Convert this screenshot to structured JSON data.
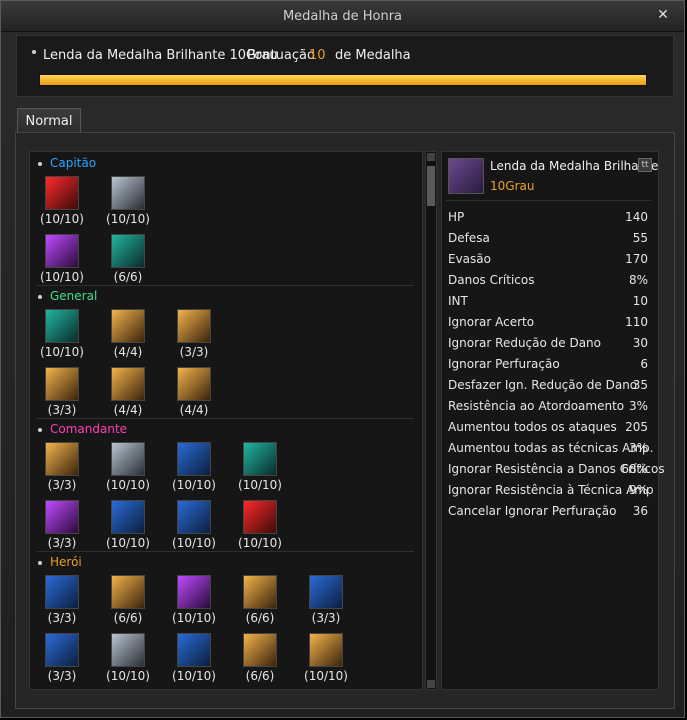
{
  "window": {
    "title": "Medalha de Honra"
  },
  "header": {
    "medal_label": "Lenda da Medalha Brilhante 10Grau",
    "score_label": "Pontuação",
    "score_value": "10",
    "medal_name": "de Medalha",
    "progress_fraction": 1.0
  },
  "tabs": [
    {
      "label": "Normal"
    }
  ],
  "groups": [
    {
      "name": "Capitão",
      "color": "#2aa7ff",
      "skills": [
        {
          "count": "(10/10)",
          "icon": "red"
        },
        {
          "count": "(10/10)",
          "icon": "silver"
        },
        {
          "count": "(10/10)",
          "icon": "purple"
        },
        {
          "count": "(6/6)",
          "icon": "green"
        }
      ]
    },
    {
      "name": "General",
      "color": "#3fe08a",
      "skills": [
        {
          "count": "(10/10)",
          "icon": "green"
        },
        {
          "count": "(4/4)",
          "icon": "gold"
        },
        {
          "count": "(3/3)",
          "icon": "gold"
        },
        {
          "count": "(3/3)",
          "icon": "gold"
        },
        {
          "count": "(4/4)",
          "icon": "gold"
        },
        {
          "count": "(4/4)",
          "icon": "gold"
        }
      ]
    },
    {
      "name": "Comandante",
      "color": "#ff3fb5",
      "skills": [
        {
          "count": "(3/3)",
          "icon": "gold"
        },
        {
          "count": "(10/10)",
          "icon": "silver"
        },
        {
          "count": "(10/10)",
          "icon": "blue"
        },
        {
          "count": "(10/10)",
          "icon": "green"
        },
        {
          "count": "(3/3)",
          "icon": "purple"
        },
        {
          "count": "(10/10)",
          "icon": "blue"
        },
        {
          "count": "(10/10)",
          "icon": "blue"
        },
        {
          "count": "(10/10)",
          "icon": "red"
        }
      ]
    },
    {
      "name": "Herói",
      "color": "#e8a12a",
      "skills": [
        {
          "count": "(3/3)",
          "icon": "blue"
        },
        {
          "count": "(6/6)",
          "icon": "gold"
        },
        {
          "count": "(10/10)",
          "icon": "purple"
        },
        {
          "count": "(6/6)",
          "icon": "gold"
        },
        {
          "count": "(3/3)",
          "icon": "blue"
        },
        {
          "count": "(3/3)",
          "icon": "blue"
        },
        {
          "count": "(10/10)",
          "icon": "silver"
        },
        {
          "count": "(10/10)",
          "icon": "blue"
        },
        {
          "count": "(6/6)",
          "icon": "gold"
        },
        {
          "count": "(10/10)",
          "icon": "gold"
        }
      ]
    }
  ],
  "detail": {
    "title": "Lenda da Medalha Brilhante",
    "grade": "10Grau",
    "lock_label": "tt",
    "stats": [
      {
        "name": "HP",
        "value": "140"
      },
      {
        "name": "Defesa",
        "value": "55"
      },
      {
        "name": "Evasão",
        "value": "170"
      },
      {
        "name": "Danos Críticos",
        "value": "8%"
      },
      {
        "name": "INT",
        "value": "10"
      },
      {
        "name": "Ignorar Acerto",
        "value": "110"
      },
      {
        "name": "Ignorar Redução de Dano",
        "value": "30"
      },
      {
        "name": "Ignorar Perfuração",
        "value": "6"
      },
      {
        "name": "Desfazer Ign. Redução de Dano",
        "value": "35"
      },
      {
        "name": "Resistência ao Atordoamento",
        "value": "3%"
      },
      {
        "name": "Aumentou todos os ataques",
        "value": "205"
      },
      {
        "name": "Aumentou todas as técnicas Amp.",
        "value": "3%"
      },
      {
        "name": "Ignorar Resistência a Danos Críticos",
        "value": "68%"
      },
      {
        "name": "Ignorar Resistência à Técnica Amp",
        "value": "9%"
      },
      {
        "name": "Cancelar Ignorar Perfuração",
        "value": "36"
      }
    ]
  }
}
